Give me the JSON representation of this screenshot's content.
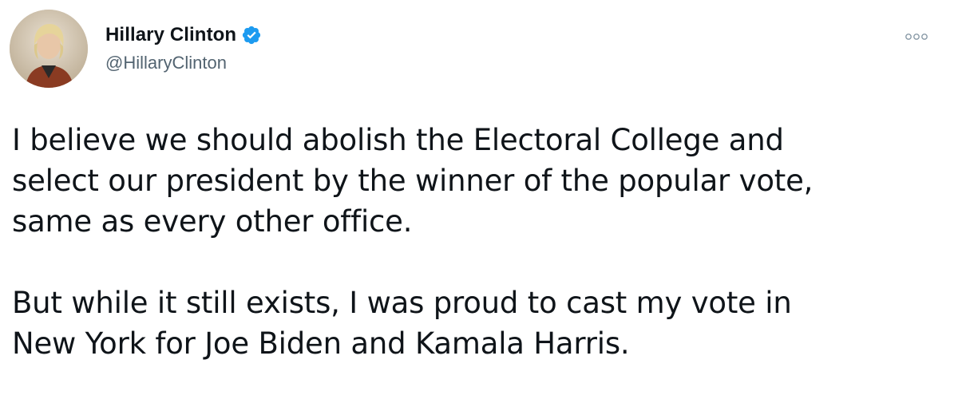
{
  "tweet": {
    "author": {
      "display_name": "Hillary Clinton",
      "handle": "@HillaryClinton",
      "verified": true,
      "avatar_icon": "profile-photo"
    },
    "more_icon": "more-options-icon",
    "paragraphs": [
      {
        "lines": [
          "I believe we should abolish the Electoral College and",
          "select our president by the winner of the popular vote,",
          "same as every other office."
        ]
      },
      {
        "lines": [
          "But while it still exists, I was proud to cast my vote in",
          "New York for Joe Biden and Kamala Harris."
        ]
      }
    ]
  },
  "colors": {
    "verified_badge": "#1d9bf0",
    "text_primary": "#0f1419",
    "text_secondary": "#536471"
  }
}
